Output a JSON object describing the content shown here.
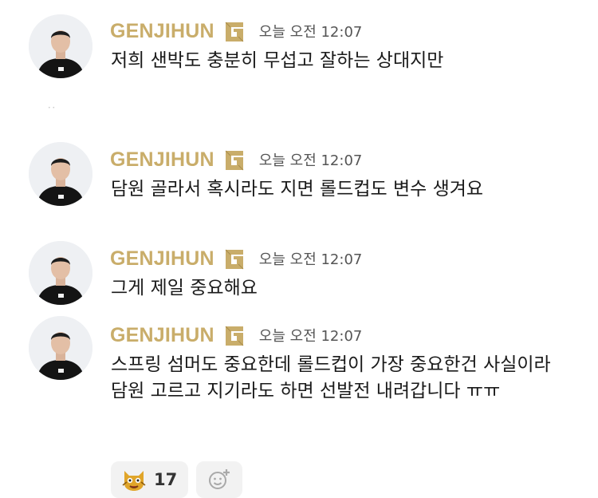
{
  "messages": [
    {
      "author": "GENJIHUN",
      "time": "오늘 오전 12:07",
      "text": "저희 샌박도 충분히 무섭고 잘하는 상대지만"
    },
    {
      "author": "GENJIHUN",
      "time": "오늘 오전 12:07",
      "text": "담원 골라서 혹시라도 지면 롤드컵도 변수 생겨요"
    },
    {
      "author": "GENJIHUN",
      "time": "오늘 오전 12:07",
      "text": "그게 제일 중요해요"
    },
    {
      "author": "GENJIHUN",
      "time": "오늘 오전 12:07",
      "text": "스프링 섬머도 중요한데 롤드컵이 가장 중요한건 사실이라\n담원 고르고 지기라도 하면 선발전 내려갑니다 ㅠㅠ"
    }
  ],
  "reactions": [
    {
      "emoji": "cat-emoji",
      "count": "17"
    }
  ],
  "colors": {
    "name": "#c9ad6a",
    "time": "#555555",
    "text": "#1a1a1a",
    "reaction_bg": "#f2f2f2"
  },
  "icons": {
    "badge": "gen-g-logo-icon",
    "add_reaction": "add-reaction-icon"
  }
}
